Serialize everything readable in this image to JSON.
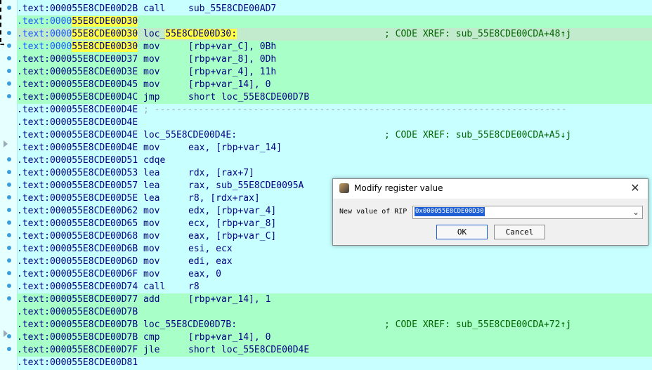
{
  "listing": [
    {
      "style": "plain",
      "addr_prefix": ".text:000055E8CDE00D2B",
      "addr_highlight": "",
      "mnemonic": "call",
      "operand": "sub_55E8CDE00AD7",
      "comment": ""
    },
    {
      "style": "green",
      "addr_prefix": ".text:0000",
      "addr_highlight": "55E8CDE00D30",
      "mnemonic": "",
      "operand": "",
      "comment": ""
    },
    {
      "style": "sel",
      "addr_prefix": ".text:0000",
      "addr_highlight": "55E8CDE00D30",
      "mnemonic": "loc_",
      "operand": "55E8CDE00D30:",
      "comment": "; CODE XREF: sub_55E8CDE00CDA+48↑j"
    },
    {
      "style": "green",
      "addr_prefix": ".text:0000",
      "addr_highlight": "55E8CDE00D30",
      "mnemonic": "mov",
      "operand": "[rbp+var_C], 0Bh",
      "comment": ""
    },
    {
      "style": "green",
      "addr_prefix": ".text:000055E8CDE00D37",
      "addr_highlight": "",
      "mnemonic": "mov",
      "operand": "[rbp+var_8], 0Dh",
      "comment": ""
    },
    {
      "style": "green",
      "addr_prefix": ".text:000055E8CDE00D3E",
      "addr_highlight": "",
      "mnemonic": "mov",
      "operand": "[rbp+var_4], 11h",
      "comment": ""
    },
    {
      "style": "green",
      "addr_prefix": ".text:000055E8CDE00D45",
      "addr_highlight": "",
      "mnemonic": "mov",
      "operand": "[rbp+var_14], 0",
      "comment": ""
    },
    {
      "style": "green",
      "addr_prefix": ".text:000055E8CDE00D4C",
      "addr_highlight": "",
      "mnemonic": "jmp",
      "operand": "short loc_55E8CDE00D7B",
      "comment": ""
    },
    {
      "style": "plain",
      "addr_prefix": ".text:000055E8CDE00D4E",
      "addr_highlight": "",
      "mnemonic": "; ---------------------------------------------------------------------------",
      "operand": "",
      "comment": ""
    },
    {
      "style": "plain",
      "addr_prefix": ".text:000055E8CDE00D4E",
      "addr_highlight": "",
      "mnemonic": "",
      "operand": "",
      "comment": ""
    },
    {
      "style": "plain",
      "addr_prefix": ".text:000055E8CDE00D4E",
      "addr_highlight": "",
      "mnemonic": "loc_55E8CDE00D4E:",
      "operand": "",
      "comment": "; CODE XREF: sub_55E8CDE00CDA+A5↓j"
    },
    {
      "style": "plain",
      "addr_prefix": ".text:000055E8CDE00D4E",
      "addr_highlight": "",
      "mnemonic": "mov",
      "operand": "eax, [rbp+var_14]",
      "comment": ""
    },
    {
      "style": "plain",
      "addr_prefix": ".text:000055E8CDE00D51",
      "addr_highlight": "",
      "mnemonic": "cdqe",
      "operand": "",
      "comment": ""
    },
    {
      "style": "plain",
      "addr_prefix": ".text:000055E8CDE00D53",
      "addr_highlight": "",
      "mnemonic": "lea",
      "operand": "rdx, [rax+7]",
      "comment": ""
    },
    {
      "style": "plain",
      "addr_prefix": ".text:000055E8CDE00D57",
      "addr_highlight": "",
      "mnemonic": "lea",
      "operand": "rax, sub_55E8CDE0095A",
      "comment": ""
    },
    {
      "style": "plain",
      "addr_prefix": ".text:000055E8CDE00D5E",
      "addr_highlight": "",
      "mnemonic": "lea",
      "operand": "r8, [rdx+rax]",
      "comment": ""
    },
    {
      "style": "plain",
      "addr_prefix": ".text:000055E8CDE00D62",
      "addr_highlight": "",
      "mnemonic": "mov",
      "operand": "edx, [rbp+var_4]",
      "comment": ""
    },
    {
      "style": "plain",
      "addr_prefix": ".text:000055E8CDE00D65",
      "addr_highlight": "",
      "mnemonic": "mov",
      "operand": "ecx, [rbp+var_8]",
      "comment": ""
    },
    {
      "style": "plain",
      "addr_prefix": ".text:000055E8CDE00D68",
      "addr_highlight": "",
      "mnemonic": "mov",
      "operand": "eax, [rbp+var_C]",
      "comment": ""
    },
    {
      "style": "plain",
      "addr_prefix": ".text:000055E8CDE00D6B",
      "addr_highlight": "",
      "mnemonic": "mov",
      "operand": "esi, ecx",
      "comment": ""
    },
    {
      "style": "plain",
      "addr_prefix": ".text:000055E8CDE00D6D",
      "addr_highlight": "",
      "mnemonic": "mov",
      "operand": "edi, eax",
      "comment": ""
    },
    {
      "style": "plain",
      "addr_prefix": ".text:000055E8CDE00D6F",
      "addr_highlight": "",
      "mnemonic": "mov",
      "operand": "eax, 0",
      "comment": ""
    },
    {
      "style": "plain",
      "addr_prefix": ".text:000055E8CDE00D74",
      "addr_highlight": "",
      "mnemonic": "call",
      "operand": "r8",
      "comment": ""
    },
    {
      "style": "green",
      "addr_prefix": ".text:000055E8CDE00D77",
      "addr_highlight": "",
      "mnemonic": "add",
      "operand": "[rbp+var_14], 1",
      "comment": ""
    },
    {
      "style": "green",
      "addr_prefix": ".text:000055E8CDE00D7B",
      "addr_highlight": "",
      "mnemonic": "",
      "operand": "",
      "comment": ""
    },
    {
      "style": "green",
      "addr_prefix": ".text:000055E8CDE00D7B",
      "addr_highlight": "",
      "mnemonic": "loc_55E8CDE00D7B:",
      "operand": "",
      "comment": "; CODE XREF: sub_55E8CDE00CDA+72↑j"
    },
    {
      "style": "green",
      "addr_prefix": ".text:000055E8CDE00D7B",
      "addr_highlight": "",
      "mnemonic": "cmp",
      "operand": "[rbp+var_14], 0",
      "comment": ""
    },
    {
      "style": "green",
      "addr_prefix": ".text:000055E8CDE00D7F",
      "addr_highlight": "",
      "mnemonic": "jle",
      "operand": "short loc_55E8CDE00D4E",
      "comment": ""
    },
    {
      "style": "plain",
      "addr_prefix": ".text:000055E8CDE00D81",
      "addr_highlight": "",
      "mnemonic": "",
      "operand": "",
      "comment": ""
    }
  ],
  "dialog": {
    "title": "Modify register value",
    "label": "New value of RIP",
    "value": "0x000055E8CDE00D30",
    "ok_label": "OK",
    "cancel_label": "Cancel",
    "close_glyph": "✕",
    "chevron_glyph": "⌄"
  },
  "colors": {
    "background": "#c8ffff",
    "executed_row": "#a8ffc8",
    "address_text": "#000080",
    "highlight_yellow": "#ffff44",
    "selection_blue": "#1e5fd6"
  }
}
